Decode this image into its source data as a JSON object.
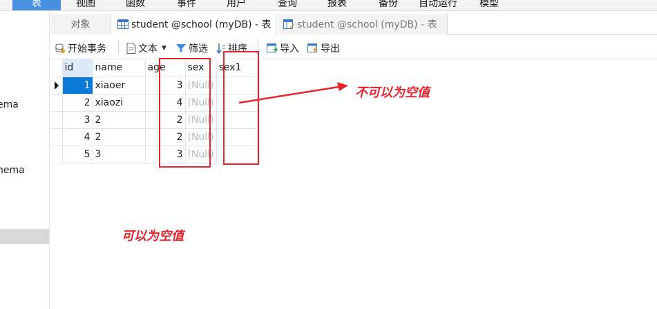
{
  "menubar": {
    "items": [
      "表",
      "视图",
      "函数",
      "事件",
      "用户",
      "查询",
      "报表",
      "备份",
      "自动运行",
      "模型"
    ]
  },
  "sidebar": {
    "items": [
      "ema",
      "nema"
    ]
  },
  "tabs": {
    "objects": "对象",
    "active": "student @school (myDB) - 表",
    "inactive": "student @school (myDB) - 表"
  },
  "toolbar": {
    "begin_transaction": "开始事务",
    "text": "文本",
    "filter": "筛选",
    "sort": "排序",
    "import": "导入",
    "export": "导出"
  },
  "grid": {
    "columns": [
      "id",
      "name",
      "age",
      "sex",
      "sex1"
    ],
    "rows": [
      {
        "id": "1",
        "name": "xiaoer",
        "age": "3",
        "sex": "(Null)",
        "sex1": ""
      },
      {
        "id": "2",
        "name": "xiaozi",
        "age": "4",
        "sex": "(Null)",
        "sex1": ""
      },
      {
        "id": "3",
        "name": "2",
        "age": "2",
        "sex": "(Null)",
        "sex1": ""
      },
      {
        "id": "4",
        "name": "2",
        "age": "2",
        "sex": "(Null)",
        "sex1": ""
      },
      {
        "id": "5",
        "name": "3",
        "age": "3",
        "sex": "(Null)",
        "sex1": ""
      }
    ]
  },
  "annotations": {
    "not_nullable": "不可以为空值",
    "nullable": "可以为空值",
    "color": "#e8232b"
  },
  "colors": {
    "selection": "#0b79d6",
    "header_highlight": "#dbe9f8",
    "null_text": "#b9b9b9"
  }
}
